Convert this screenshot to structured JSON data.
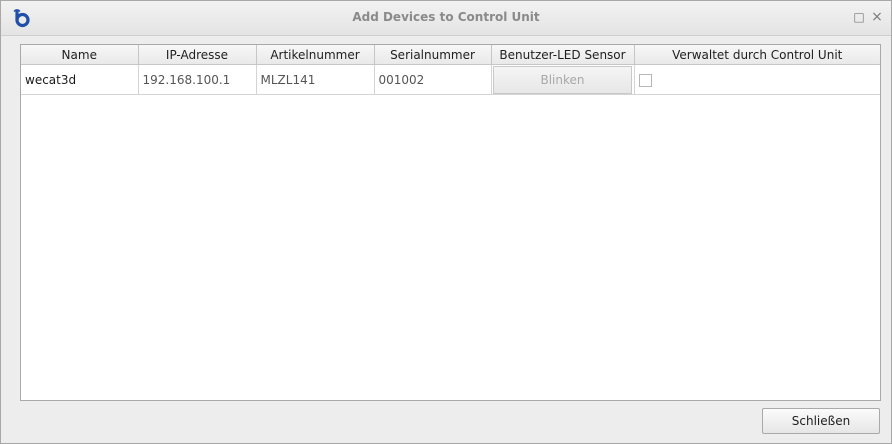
{
  "window": {
    "title": "Add Devices to Control Unit",
    "maximize_glyph": "□",
    "close_glyph": "×",
    "logo_icon": "app-logo-icon",
    "accent_color": "#1f4fa8"
  },
  "table": {
    "columns": [
      "Name",
      "IP-Adresse",
      "Artikelnummer",
      "Serialnummer",
      "Benutzer-LED Sensor",
      "Verwaltet durch Control Unit"
    ],
    "rows": [
      {
        "name": "wecat3d",
        "ip": "192.168.100.1",
        "article": "MLZL141",
        "serial": "001002",
        "led_button": "Blinken",
        "managed": false
      }
    ]
  },
  "footer": {
    "close_label": "Schließen"
  }
}
